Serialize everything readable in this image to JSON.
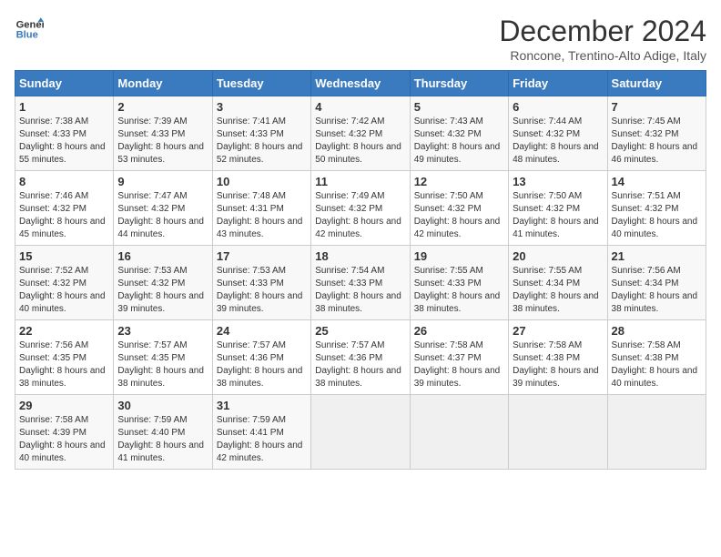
{
  "header": {
    "logo_line1": "General",
    "logo_line2": "Blue",
    "month_title": "December 2024",
    "subtitle": "Roncone, Trentino-Alto Adige, Italy"
  },
  "weekdays": [
    "Sunday",
    "Monday",
    "Tuesday",
    "Wednesday",
    "Thursday",
    "Friday",
    "Saturday"
  ],
  "weeks": [
    [
      {
        "day": "1",
        "sunrise": "Sunrise: 7:38 AM",
        "sunset": "Sunset: 4:33 PM",
        "daylight": "Daylight: 8 hours and 55 minutes."
      },
      {
        "day": "2",
        "sunrise": "Sunrise: 7:39 AM",
        "sunset": "Sunset: 4:33 PM",
        "daylight": "Daylight: 8 hours and 53 minutes."
      },
      {
        "day": "3",
        "sunrise": "Sunrise: 7:41 AM",
        "sunset": "Sunset: 4:33 PM",
        "daylight": "Daylight: 8 hours and 52 minutes."
      },
      {
        "day": "4",
        "sunrise": "Sunrise: 7:42 AM",
        "sunset": "Sunset: 4:32 PM",
        "daylight": "Daylight: 8 hours and 50 minutes."
      },
      {
        "day": "5",
        "sunrise": "Sunrise: 7:43 AM",
        "sunset": "Sunset: 4:32 PM",
        "daylight": "Daylight: 8 hours and 49 minutes."
      },
      {
        "day": "6",
        "sunrise": "Sunrise: 7:44 AM",
        "sunset": "Sunset: 4:32 PM",
        "daylight": "Daylight: 8 hours and 48 minutes."
      },
      {
        "day": "7",
        "sunrise": "Sunrise: 7:45 AM",
        "sunset": "Sunset: 4:32 PM",
        "daylight": "Daylight: 8 hours and 46 minutes."
      }
    ],
    [
      {
        "day": "8",
        "sunrise": "Sunrise: 7:46 AM",
        "sunset": "Sunset: 4:32 PM",
        "daylight": "Daylight: 8 hours and 45 minutes."
      },
      {
        "day": "9",
        "sunrise": "Sunrise: 7:47 AM",
        "sunset": "Sunset: 4:32 PM",
        "daylight": "Daylight: 8 hours and 44 minutes."
      },
      {
        "day": "10",
        "sunrise": "Sunrise: 7:48 AM",
        "sunset": "Sunset: 4:31 PM",
        "daylight": "Daylight: 8 hours and 43 minutes."
      },
      {
        "day": "11",
        "sunrise": "Sunrise: 7:49 AM",
        "sunset": "Sunset: 4:32 PM",
        "daylight": "Daylight: 8 hours and 42 minutes."
      },
      {
        "day": "12",
        "sunrise": "Sunrise: 7:50 AM",
        "sunset": "Sunset: 4:32 PM",
        "daylight": "Daylight: 8 hours and 42 minutes."
      },
      {
        "day": "13",
        "sunrise": "Sunrise: 7:50 AM",
        "sunset": "Sunset: 4:32 PM",
        "daylight": "Daylight: 8 hours and 41 minutes."
      },
      {
        "day": "14",
        "sunrise": "Sunrise: 7:51 AM",
        "sunset": "Sunset: 4:32 PM",
        "daylight": "Daylight: 8 hours and 40 minutes."
      }
    ],
    [
      {
        "day": "15",
        "sunrise": "Sunrise: 7:52 AM",
        "sunset": "Sunset: 4:32 PM",
        "daylight": "Daylight: 8 hours and 40 minutes."
      },
      {
        "day": "16",
        "sunrise": "Sunrise: 7:53 AM",
        "sunset": "Sunset: 4:32 PM",
        "daylight": "Daylight: 8 hours and 39 minutes."
      },
      {
        "day": "17",
        "sunrise": "Sunrise: 7:53 AM",
        "sunset": "Sunset: 4:33 PM",
        "daylight": "Daylight: 8 hours and 39 minutes."
      },
      {
        "day": "18",
        "sunrise": "Sunrise: 7:54 AM",
        "sunset": "Sunset: 4:33 PM",
        "daylight": "Daylight: 8 hours and 38 minutes."
      },
      {
        "day": "19",
        "sunrise": "Sunrise: 7:55 AM",
        "sunset": "Sunset: 4:33 PM",
        "daylight": "Daylight: 8 hours and 38 minutes."
      },
      {
        "day": "20",
        "sunrise": "Sunrise: 7:55 AM",
        "sunset": "Sunset: 4:34 PM",
        "daylight": "Daylight: 8 hours and 38 minutes."
      },
      {
        "day": "21",
        "sunrise": "Sunrise: 7:56 AM",
        "sunset": "Sunset: 4:34 PM",
        "daylight": "Daylight: 8 hours and 38 minutes."
      }
    ],
    [
      {
        "day": "22",
        "sunrise": "Sunrise: 7:56 AM",
        "sunset": "Sunset: 4:35 PM",
        "daylight": "Daylight: 8 hours and 38 minutes."
      },
      {
        "day": "23",
        "sunrise": "Sunrise: 7:57 AM",
        "sunset": "Sunset: 4:35 PM",
        "daylight": "Daylight: 8 hours and 38 minutes."
      },
      {
        "day": "24",
        "sunrise": "Sunrise: 7:57 AM",
        "sunset": "Sunset: 4:36 PM",
        "daylight": "Daylight: 8 hours and 38 minutes."
      },
      {
        "day": "25",
        "sunrise": "Sunrise: 7:57 AM",
        "sunset": "Sunset: 4:36 PM",
        "daylight": "Daylight: 8 hours and 38 minutes."
      },
      {
        "day": "26",
        "sunrise": "Sunrise: 7:58 AM",
        "sunset": "Sunset: 4:37 PM",
        "daylight": "Daylight: 8 hours and 39 minutes."
      },
      {
        "day": "27",
        "sunrise": "Sunrise: 7:58 AM",
        "sunset": "Sunset: 4:38 PM",
        "daylight": "Daylight: 8 hours and 39 minutes."
      },
      {
        "day": "28",
        "sunrise": "Sunrise: 7:58 AM",
        "sunset": "Sunset: 4:38 PM",
        "daylight": "Daylight: 8 hours and 40 minutes."
      }
    ],
    [
      {
        "day": "29",
        "sunrise": "Sunrise: 7:58 AM",
        "sunset": "Sunset: 4:39 PM",
        "daylight": "Daylight: 8 hours and 40 minutes."
      },
      {
        "day": "30",
        "sunrise": "Sunrise: 7:59 AM",
        "sunset": "Sunset: 4:40 PM",
        "daylight": "Daylight: 8 hours and 41 minutes."
      },
      {
        "day": "31",
        "sunrise": "Sunrise: 7:59 AM",
        "sunset": "Sunset: 4:41 PM",
        "daylight": "Daylight: 8 hours and 42 minutes."
      },
      null,
      null,
      null,
      null
    ]
  ]
}
